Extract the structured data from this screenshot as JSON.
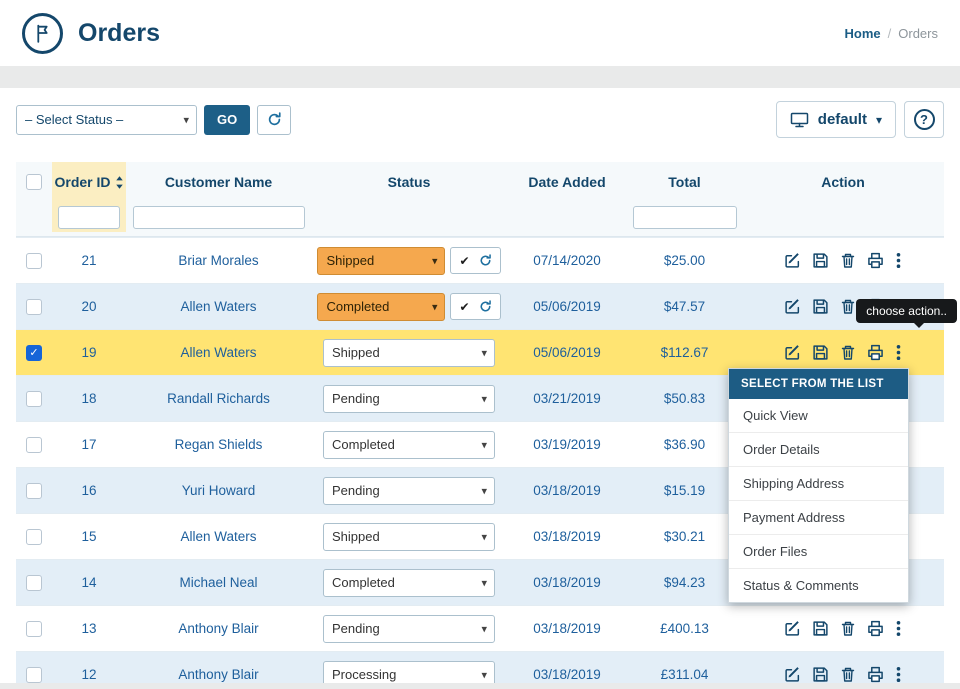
{
  "header": {
    "title": "Orders",
    "breadcrumb": {
      "home": "Home",
      "separator": "/",
      "current": "Orders"
    }
  },
  "toolbar": {
    "status_select_value": "– Select Status –",
    "go": "GO",
    "default_label": "default",
    "help": "?"
  },
  "table": {
    "columns": {
      "order_id": "Order ID",
      "customer": "Customer Name",
      "status": "Status",
      "date_added": "Date Added",
      "total": "Total",
      "action": "Action"
    },
    "filters": {
      "order_id": "",
      "customer": "",
      "total": ""
    },
    "rows": [
      {
        "id": "21",
        "customer": "Briar Morales",
        "status": "Shipped",
        "date": "07/14/2020",
        "total": "$25.00",
        "pending_confirm": true,
        "checked": false,
        "highlight": false
      },
      {
        "id": "20",
        "customer": "Allen Waters",
        "status": "Completed",
        "date": "05/06/2019",
        "total": "$47.57",
        "pending_confirm": true,
        "checked": false,
        "highlight": false
      },
      {
        "id": "19",
        "customer": "Allen Waters",
        "status": "Shipped",
        "date": "05/06/2019",
        "total": "$112.67",
        "pending_confirm": false,
        "checked": true,
        "highlight": true
      },
      {
        "id": "18",
        "customer": "Randall Richards",
        "status": "Pending",
        "date": "03/21/2019",
        "total": "$50.83",
        "pending_confirm": false,
        "checked": false,
        "highlight": false
      },
      {
        "id": "17",
        "customer": "Regan Shields",
        "status": "Completed",
        "date": "03/19/2019",
        "total": "$36.90",
        "pending_confirm": false,
        "checked": false,
        "highlight": false
      },
      {
        "id": "16",
        "customer": "Yuri Howard",
        "status": "Pending",
        "date": "03/18/2019",
        "total": "$15.19",
        "pending_confirm": false,
        "checked": false,
        "highlight": false
      },
      {
        "id": "15",
        "customer": "Allen Waters",
        "status": "Shipped",
        "date": "03/18/2019",
        "total": "$30.21",
        "pending_confirm": false,
        "checked": false,
        "highlight": false
      },
      {
        "id": "14",
        "customer": "Michael Neal",
        "status": "Completed",
        "date": "03/18/2019",
        "total": "$94.23",
        "pending_confirm": false,
        "checked": false,
        "highlight": false
      },
      {
        "id": "13",
        "customer": "Anthony Blair",
        "status": "Pending",
        "date": "03/18/2019",
        "total": "£400.13",
        "pending_confirm": false,
        "checked": false,
        "highlight": false
      },
      {
        "id": "12",
        "customer": "Anthony Blair",
        "status": "Processing",
        "date": "03/18/2019",
        "total": "£311.04",
        "pending_confirm": false,
        "checked": false,
        "highlight": false
      }
    ]
  },
  "tooltip": "choose action..",
  "context_menu": {
    "header": "SELECT FROM THE LIST",
    "items": [
      "Quick View",
      "Order Details",
      "Shipping Address",
      "Payment Address",
      "Order Files",
      "Status & Comments"
    ]
  },
  "colors": {
    "navy": "#14476b",
    "link_blue": "#1e5f9c",
    "row_alt": "#e3eef7",
    "row_selected": "#ffe472",
    "status_changed": "#f5a84e",
    "primary_button": "#1d5f87",
    "sorted_column_highlight": "#fbeec2"
  }
}
